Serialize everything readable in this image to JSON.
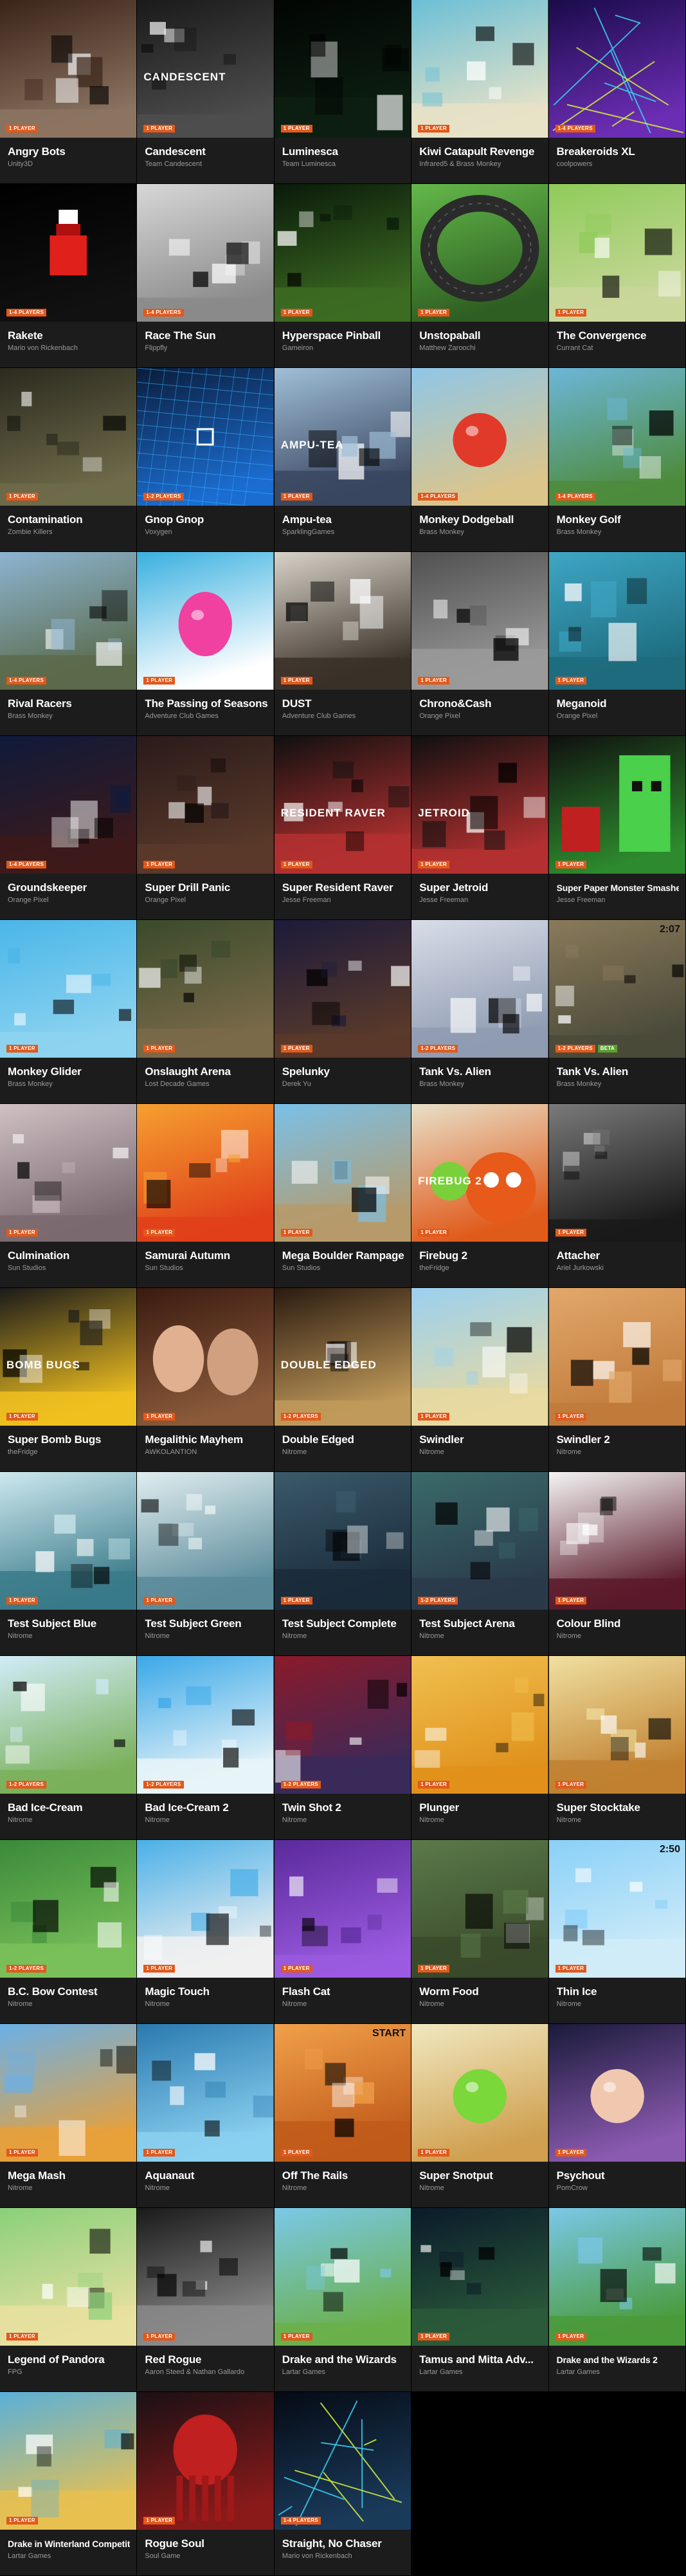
{
  "colors": {
    "badge": "#e2581a",
    "badge_green": "#5aa02c",
    "tile_bg": "#1c1c1c",
    "title": "#ffffff",
    "developer": "#9a9a9a"
  },
  "games": [
    {
      "title": "Angry Bots",
      "developer": "Unity3D",
      "badges": [
        "1 PLAYER"
      ],
      "thumb": {
        "icon": "factory-scene",
        "c1": "#3a2418",
        "c2": "#8c7462"
      }
    },
    {
      "title": "Candescent",
      "developer": "Team Candescent",
      "badges": [
        "1 PLAYER"
      ],
      "thumb": {
        "icon": "candescent-logo",
        "c1": "#1a1a1a",
        "c2": "#4d4d4d",
        "text": "CANDESCENT"
      }
    },
    {
      "title": "Luminesca",
      "developer": "Team Luminesca",
      "badges": [
        "1 PLAYER"
      ],
      "thumb": {
        "icon": "dark-cave",
        "c1": "#020503",
        "c2": "#0d1f12"
      }
    },
    {
      "title": "Kiwi Catapult Revenge",
      "developer": "Infrared5 & Brass Monkey",
      "badges": [
        "1 PLAYER"
      ],
      "thumb": {
        "icon": "owl-character",
        "c1": "#6bbfd6",
        "c2": "#e7e2c7"
      }
    },
    {
      "title": "Breakeroids XL",
      "developer": "coolpowers",
      "badges": [
        "1-4 PLAYERS"
      ],
      "thumb": {
        "icon": "neon-lines",
        "c1": "#1a0b4a",
        "c2": "#6b2db3"
      }
    },
    {
      "title": "Rakete",
      "developer": "Mario von Rickenbach",
      "badges": [
        "1-4 PLAYERS"
      ],
      "thumb": {
        "icon": "red-rocket",
        "c1": "#000000",
        "c2": "#111111"
      }
    },
    {
      "title": "Race The Sun",
      "developer": "Flippfly",
      "badges": [
        "1-4 PLAYERS"
      ],
      "thumb": {
        "icon": "white-landscape",
        "c1": "#d7d7d7",
        "c2": "#8a8a8a"
      }
    },
    {
      "title": "Hyperspace Pinball",
      "developer": "Gameiron",
      "badges": [
        "1 PLAYER"
      ],
      "thumb": {
        "icon": "pinball",
        "c1": "#0a1a0a",
        "c2": "#3c6b22"
      }
    },
    {
      "title": "Unstopaball",
      "developer": "Matthew Zaroochi",
      "badges": [
        "1 PLAYER"
      ],
      "thumb": {
        "icon": "ring-track",
        "c1": "#64b84a",
        "c2": "#2e5e22"
      }
    },
    {
      "title": "The Convergence",
      "developer": "Currant Cat",
      "badges": [
        "1 PLAYER"
      ],
      "thumb": {
        "icon": "pixel-kids",
        "c1": "#8fcb5a",
        "c2": "#c9d79a"
      }
    },
    {
      "title": "Contamination",
      "developer": "Zombie Killers",
      "badges": [
        "1 PLAYER"
      ],
      "thumb": {
        "icon": "light-beams",
        "c1": "#2b2a1e",
        "c2": "#6f6b4a"
      }
    },
    {
      "title": "Gnop Gnop",
      "developer": "Voxygen",
      "badges": [
        "1-2 PLAYERS"
      ],
      "thumb": {
        "icon": "blue-grid",
        "c1": "#0a1c3a",
        "c2": "#1b6dd1"
      }
    },
    {
      "title": "Ampu-tea",
      "developer": "SparklingGames",
      "badges": [
        "1 PLAYER"
      ],
      "thumb": {
        "icon": "robot-tea",
        "c1": "#a0bfd8",
        "c2": "#3a4660",
        "text": "AMPU-TEA"
      }
    },
    {
      "title": "Monkey Dodgeball",
      "developer": "Brass Monkey",
      "badges": [
        "1-4 PLAYERS"
      ],
      "thumb": {
        "icon": "beach-ball",
        "c1": "#8fc6e8",
        "c2": "#dcc58a"
      }
    },
    {
      "title": "Monkey Golf",
      "developer": "Brass Monkey",
      "badges": [
        "1-4 PLAYERS"
      ],
      "thumb": {
        "icon": "golf-course",
        "c1": "#6cb6d9",
        "c2": "#4e8b3c"
      }
    },
    {
      "title": "Rival Racers",
      "developer": "Brass Monkey",
      "badges": [
        "1-4 PLAYERS"
      ],
      "thumb": {
        "icon": "race-road",
        "c1": "#8db4d1",
        "c2": "#5a6a4a"
      }
    },
    {
      "title": "The Passing of Seasons",
      "developer": "Adventure Club Games",
      "badges": [
        "1 PLAYER"
      ],
      "thumb": {
        "icon": "pink-egg",
        "c1": "#3ab0e0",
        "c2": "#ffffff"
      }
    },
    {
      "title": "DUST",
      "developer": "Adventure Club Games",
      "badges": [
        "1 PLAYER"
      ],
      "thumb": {
        "icon": "shadow-creature",
        "c1": "#d8d3c9",
        "c2": "#3a3028"
      }
    },
    {
      "title": "Chrono&Cash",
      "developer": "Orange Pixel",
      "badges": [
        "1 PLAYER"
      ],
      "thumb": {
        "icon": "pixel-platform",
        "c1": "#505050",
        "c2": "#9a9a9a"
      }
    },
    {
      "title": "Meganoid",
      "developer": "Orange Pixel",
      "badges": [
        "1 PLAYER"
      ],
      "thumb": {
        "icon": "pixel-blocks",
        "c1": "#3ea6c4",
        "c2": "#1d6b7d"
      }
    },
    {
      "title": "Groundskeeper",
      "developer": "Orange Pixel",
      "badges": [
        "1-4 PLAYERS"
      ],
      "thumb": {
        "icon": "pixel-skulls",
        "c1": "#0f1a3a",
        "c2": "#3d1a1a"
      }
    },
    {
      "title": "Super Drill Panic",
      "developer": "Orange Pixel",
      "badges": [
        "1 PLAYER"
      ],
      "thumb": {
        "icon": "drill-cave",
        "c1": "#2a1a1a",
        "c2": "#5a3a2a"
      }
    },
    {
      "title": "Super Resident Raver",
      "developer": "Jesse Freeman",
      "badges": [
        "1 PLAYER"
      ],
      "thumb": {
        "icon": "raver-pixel",
        "c1": "#101010",
        "c2": "#b43030",
        "text": "RESIDENT RAVER"
      }
    },
    {
      "title": "Super Jetroid",
      "developer": "Jesse Freeman",
      "badges": [
        "1 PLAYER"
      ],
      "thumb": {
        "icon": "jetroid-pixel",
        "c1": "#101010",
        "c2": "#b43030",
        "text": "JETROID"
      }
    },
    {
      "title": "Super Paper Monster Smasher",
      "developer": "Jesse Freeman",
      "badges": [
        "1 PLAYER"
      ],
      "thumb": {
        "icon": "green-monster",
        "c1": "#101010",
        "c2": "#2d8a2d"
      }
    },
    {
      "title": "Monkey Glider",
      "developer": "Brass Monkey",
      "badges": [
        "1 PLAYER"
      ],
      "thumb": {
        "icon": "orange-glider",
        "c1": "#4ab6e8",
        "c2": "#8dd3f0"
      }
    },
    {
      "title": "Onslaught Arena",
      "developer": "Lost Decade Games",
      "badges": [
        "1 PLAYER"
      ],
      "thumb": {
        "icon": "arena-walls",
        "c1": "#3a4a2a",
        "c2": "#7a6a4a"
      }
    },
    {
      "title": "Spelunky",
      "developer": "Derek Yu",
      "badges": [
        "1 PLAYER"
      ],
      "thumb": {
        "icon": "cave-pixel",
        "c1": "#1c1a3a",
        "c2": "#5a3a2a"
      }
    },
    {
      "title": "Tank Vs. Alien",
      "developer": "Brass Monkey",
      "badges": [
        "1-2 PLAYERS"
      ],
      "thumb": {
        "icon": "snow-tank",
        "c1": "#d9dde8",
        "c2": "#8e9bb1"
      }
    },
    {
      "title": "Tank Vs. Alien",
      "developer": "Brass Monkey",
      "badges": [
        "1-2 PLAYERS",
        "BETA"
      ],
      "thumb": {
        "icon": "desert-tank",
        "c1": "#8a7a5a",
        "c2": "#4a4a3a",
        "text": "2:07"
      }
    },
    {
      "title": "Culmination",
      "developer": "Sun Studios",
      "badges": [
        "1 PLAYER"
      ],
      "thumb": {
        "icon": "swirl-figure",
        "c1": "#cfc0c4",
        "c2": "#7a6a70"
      }
    },
    {
      "title": "Samurai Autumn",
      "developer": "Sun Studios",
      "badges": [
        "1 PLAYER"
      ],
      "thumb": {
        "icon": "fire-explosion",
        "c1": "#f5a030",
        "c2": "#e0401a"
      }
    },
    {
      "title": "Mega Boulder Rampage",
      "developer": "Sun Studios",
      "badges": [
        "1 PLAYER"
      ],
      "thumb": {
        "icon": "mountain-sky",
        "c1": "#7ac0e8",
        "c2": "#b69a6a"
      }
    },
    {
      "title": "Firebug 2",
      "developer": "theFridge",
      "badges": [
        "1 PLAYER"
      ],
      "thumb": {
        "icon": "firebug",
        "c1": "#e8e0c8",
        "c2": "#e05a1a",
        "text": "FIREBUG 2"
      }
    },
    {
      "title": "Attacher",
      "developer": "Ariel Jurkowski",
      "badges": [
        "1 PLAYER"
      ],
      "thumb": {
        "icon": "grey-silhouette",
        "c1": "#7a7a7a",
        "c2": "#1a1a1a"
      }
    },
    {
      "title": "Super Bomb Bugs",
      "developer": "theFridge",
      "badges": [
        "1 PLAYER"
      ],
      "thumb": {
        "icon": "bomb-bugs",
        "c1": "#1a1a1a",
        "c2": "#f0c020",
        "text": "BOMB BUGS"
      }
    },
    {
      "title": "Megalithic Mayhem",
      "developer": "AWKOLANTION",
      "badges": [
        "1 PLAYER"
      ],
      "thumb": {
        "icon": "two-faces",
        "c1": "#3a1a10",
        "c2": "#8a5a3a"
      }
    },
    {
      "title": "Double Edged",
      "developer": "Nitrome",
      "badges": [
        "1-2 PLAYERS"
      ],
      "thumb": {
        "icon": "double-edged",
        "c1": "#2a1a10",
        "c2": "#c09a5a",
        "text": "DOUBLE EDGED"
      }
    },
    {
      "title": "Swindler",
      "developer": "Nitrome",
      "badges": [
        "1 PLAYER"
      ],
      "thumb": {
        "icon": "swindler",
        "c1": "#9ad0f0",
        "c2": "#e8d9a0"
      }
    },
    {
      "title": "Swindler 2",
      "developer": "Nitrome",
      "badges": [
        "1 PLAYER"
      ],
      "thumb": {
        "icon": "swindler-2",
        "c1": "#e2a86a",
        "c2": "#c07a3a"
      }
    },
    {
      "title": "Test Subject Blue",
      "developer": "Nitrome",
      "badges": [
        "1 PLAYER"
      ],
      "thumb": {
        "icon": "lab-blue",
        "c1": "#cde8ee",
        "c2": "#3a7a8a"
      }
    },
    {
      "title": "Test Subject Green",
      "developer": "Nitrome",
      "badges": [
        "1 PLAYER"
      ],
      "thumb": {
        "icon": "lab-green",
        "c1": "#e0eef0",
        "c2": "#5a8a9a"
      }
    },
    {
      "title": "Test Subject Complete",
      "developer": "Nitrome",
      "badges": [
        "1 PLAYER"
      ],
      "thumb": {
        "icon": "lab-dark",
        "c1": "#3a5a6a",
        "c2": "#1a2a3a"
      }
    },
    {
      "title": "Test Subject Arena",
      "developer": "Nitrome",
      "badges": [
        "1-2 PLAYERS"
      ],
      "thumb": {
        "icon": "lab-arena",
        "c1": "#3a6a6a",
        "c2": "#2a3a4a"
      }
    },
    {
      "title": "Colour Blind",
      "developer": "Nitrome",
      "badges": [
        "1 PLAYER"
      ],
      "thumb": {
        "icon": "white-level",
        "c1": "#f4f4f4",
        "c2": "#5a1a2a"
      }
    },
    {
      "title": "Bad Ice-Cream",
      "developer": "Nitrome",
      "badges": [
        "1-2 PLAYERS"
      ],
      "thumb": {
        "icon": "ice-level",
        "c1": "#d0ecf8",
        "c2": "#7ab05a"
      }
    },
    {
      "title": "Bad Ice-Cream 2",
      "developer": "Nitrome",
      "badges": [
        "1-2 PLAYERS"
      ],
      "thumb": {
        "icon": "ice-level-2",
        "c1": "#3aa8e8",
        "c2": "#e8f4f8"
      }
    },
    {
      "title": "Twin Shot 2",
      "developer": "Nitrome",
      "badges": [
        "1-2 PLAYERS"
      ],
      "thumb": {
        "icon": "red-level",
        "c1": "#8a1a2a",
        "c2": "#3a2a5a"
      }
    },
    {
      "title": "Plunger",
      "developer": "Nitrome",
      "badges": [
        "1 PLAYER"
      ],
      "thumb": {
        "icon": "yellow-level",
        "c1": "#f0c050",
        "c2": "#e0901a"
      }
    },
    {
      "title": "Super Stocktake",
      "developer": "Nitrome",
      "badges": [
        "1 PLAYER"
      ],
      "thumb": {
        "icon": "warehouse",
        "c1": "#f0e0a0",
        "c2": "#c08030"
      }
    },
    {
      "title": "B.C. Bow Contest",
      "developer": "Nitrome",
      "badges": [
        "1-2 PLAYERS"
      ],
      "thumb": {
        "icon": "bow-target",
        "c1": "#3a8a3a",
        "c2": "#7ac05a"
      }
    },
    {
      "title": "Magic Touch",
      "developer": "Nitrome",
      "badges": [
        "1 PLAYER"
      ],
      "thumb": {
        "icon": "balloon-sky",
        "c1": "#4ab0e8",
        "c2": "#f0f0f0"
      }
    },
    {
      "title": "Flash Cat",
      "developer": "Nitrome",
      "badges": [
        "1 PLAYER"
      ],
      "thumb": {
        "icon": "purple-beam",
        "c1": "#5a2a9a",
        "c2": "#9a5ae0"
      }
    },
    {
      "title": "Worm Food",
      "developer": "Nitrome",
      "badges": [
        "1 PLAYER"
      ],
      "thumb": {
        "icon": "dirt-level",
        "c1": "#5a7a4a",
        "c2": "#3a4a2a"
      }
    },
    {
      "title": "Thin Ice",
      "developer": "Nitrome",
      "badges": [
        "1 PLAYER"
      ],
      "thumb": {
        "icon": "sky-ice",
        "c1": "#8ad0f8",
        "c2": "#d0ecf8",
        "text": "2:50"
      }
    },
    {
      "title": "Mega Mash",
      "developer": "Nitrome",
      "badges": [
        "1 PLAYER"
      ],
      "thumb": {
        "icon": "mash-level",
        "c1": "#6ab0e8",
        "c2": "#e8a03a"
      }
    },
    {
      "title": "Aquanaut",
      "developer": "Nitrome",
      "badges": [
        "1 PLAYER"
      ],
      "thumb": {
        "icon": "underwater",
        "c1": "#2a7ab0",
        "c2": "#8ad0f0"
      }
    },
    {
      "title": "Off The Rails",
      "developer": "Nitrome",
      "badges": [
        "1 PLAYER"
      ],
      "thumb": {
        "icon": "desert-rails",
        "c1": "#f0a04a",
        "c2": "#c05a1a",
        "text": "START"
      }
    },
    {
      "title": "Super Snotput",
      "developer": "Nitrome",
      "badges": [
        "1 PLAYER"
      ],
      "thumb": {
        "icon": "green-blob",
        "c1": "#f0e8c0",
        "c2": "#d0a050"
      }
    },
    {
      "title": "Psychout",
      "developer": "PomCrow",
      "badges": [
        "1 PLAYER"
      ],
      "thumb": {
        "icon": "baby-face",
        "c1": "#1a1a3a",
        "c2": "#8a5ab0"
      }
    },
    {
      "title": "Legend of Pandora",
      "developer": "FPG",
      "badges": [
        "1 PLAYER"
      ],
      "thumb": {
        "icon": "zelda-like",
        "c1": "#8ad07a",
        "c2": "#e8e0a0"
      }
    },
    {
      "title": "Red Rogue",
      "developer": "Aaron Steed & Nathan Gallardo",
      "badges": [
        "1 PLAYER"
      ],
      "thumb": {
        "icon": "grey-dungeon",
        "c1": "#1a1a1a",
        "c2": "#8a8a8a"
      }
    },
    {
      "title": "Drake and the Wizards",
      "developer": "Lartar Games",
      "badges": [
        "1 PLAYER"
      ],
      "thumb": {
        "icon": "drake-sky",
        "c1": "#7ac8e8",
        "c2": "#6ab04a"
      }
    },
    {
      "title": "Tamus and Mitta Adv...",
      "developer": "Lartar Games",
      "badges": [
        "1 PLAYER"
      ],
      "thumb": {
        "icon": "planet-dark",
        "c1": "#0a1a2a",
        "c2": "#2a5a3a"
      }
    },
    {
      "title": "Drake and the Wizards 2",
      "developer": "Lartar Games",
      "badges": [
        "1 PLAYER"
      ],
      "thumb": {
        "icon": "drake-sky-2",
        "c1": "#7ac8e8",
        "c2": "#4a9a3a"
      }
    },
    {
      "title": "Drake in Winterland Competition",
      "developer": "Lartar Games",
      "badges": [
        "1 PLAYER"
      ],
      "thumb": {
        "icon": "winter-drake",
        "c1": "#5ab0d8",
        "c2": "#e8c050"
      }
    },
    {
      "title": "Rogue Soul",
      "developer": "Soul Game",
      "badges": [
        "1 PLAYER"
      ],
      "thumb": {
        "icon": "red-octopus",
        "c1": "#1a1014",
        "c2": "#8a1a1a"
      }
    },
    {
      "title": "Straight, No Chaser",
      "developer": "Mario von Rickenbach",
      "badges": [
        "1-4 PLAYERS"
      ],
      "thumb": {
        "icon": "neon-wireframe",
        "c1": "#050a14",
        "c2": "#1a3a5a"
      }
    }
  ]
}
